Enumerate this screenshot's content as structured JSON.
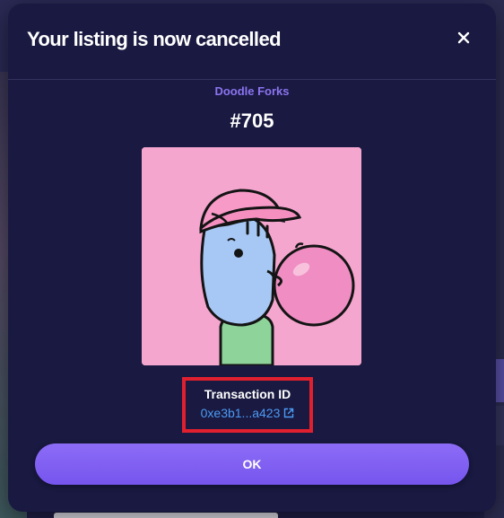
{
  "modal": {
    "title": "Your listing is now cancelled",
    "close_icon": "close-icon",
    "collection_name": "Doodle Forks",
    "token_id": "#705",
    "nft_image_icon": "nft-artwork",
    "transaction": {
      "label": "Transaction ID",
      "hash_short": "0xe3b1...a423",
      "external_icon": "external-link-icon"
    },
    "ok_label": "OK"
  },
  "colors": {
    "modal_bg": "#191941",
    "accent": "#7a5cf0",
    "link": "#4c9bf4",
    "collection": "#8b74f0",
    "highlight_border": "#e0202e",
    "nft_bg": "#f5a6cf"
  }
}
